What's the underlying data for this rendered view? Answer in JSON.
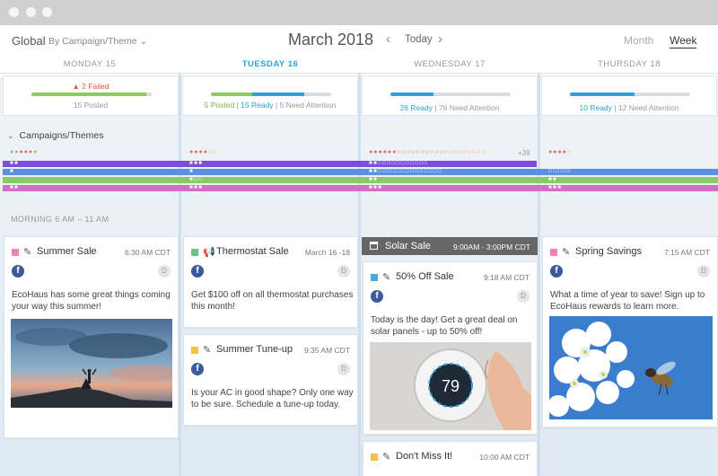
{
  "header": {
    "scope": "Global",
    "group_by": "By Campaign/Theme",
    "title": "March 2018",
    "today": "Today",
    "prev": "‹",
    "next": "›",
    "views": {
      "month": "Month",
      "week": "Week"
    }
  },
  "days": [
    {
      "label": "MONDAY 15"
    },
    {
      "label": "TUESDAY 16"
    },
    {
      "label": "WEDNESDAY 17"
    },
    {
      "label": "THURSDAY 18"
    }
  ],
  "status": {
    "monday": {
      "failed": "2 Failed",
      "posted": "15 Posted",
      "failed_icon": "warning-icon"
    },
    "tuesday": {
      "posted": "5 Posted",
      "sep": "|",
      "ready": "15 Ready",
      "sep2": "|",
      "attention": "5 Need Attention"
    },
    "wednesday": {
      "ready": "26 Ready",
      "sep": "|",
      "attention": "76 Need Attention"
    },
    "thursday": {
      "ready": "10 Ready",
      "sep": "|",
      "attention": "12 Need Attention"
    }
  },
  "campaigns": {
    "label": "Campaigns/Themes",
    "chevron": "⌄",
    "wednesday_more": "+39",
    "stripe_colors": [
      "#7b4fd6",
      "#5b8fe0",
      "#8cc865",
      "#d86bc7"
    ]
  },
  "morning_label": "MORNING 6 AM – 11 AM",
  "cards": {
    "summer_sale": {
      "title": "Summer Sale",
      "time": "6:30 AM CDT",
      "body": "EcoHaus has some great things coming your way this summer!",
      "color": "#f081b8",
      "network": "f",
      "avatar": "D"
    },
    "thermostat_sale": {
      "title": "Thermostat Sale",
      "time": "March 16 -18",
      "body": "Get $100 off on all thermostat purchases this month!",
      "color": "#6ec18a",
      "network": "f",
      "avatar": "D",
      "icon": "megaphone-icon"
    },
    "summer_tuneup": {
      "title": "Summer Tune-up",
      "time": "9:35 AM CDT",
      "body": "Is your AC in good shape? Only one way to be sure. Schedule a tune-up today.",
      "color": "#f5c343",
      "network": "f",
      "avatar": "D"
    },
    "solar_sale": {
      "title": "Solar Sale",
      "time": "9:00AM - 3:00PM CDT"
    },
    "fifty_off": {
      "title": "50% Off Sale",
      "time": "9:18 AM CDT",
      "body": "Today is the day! Get a great deal on solar panels - up to 50% off!",
      "color": "#48a8de",
      "network": "f",
      "avatar": "D",
      "thermostat_reading": "79"
    },
    "dont_miss": {
      "title": "Don't Miss It!",
      "time": "10:00 AM CDT",
      "color": "#f5c343"
    },
    "spring_savings": {
      "title": "Spring Savings",
      "time": "7:15 AM CDT",
      "body": "What a time of year to save! Sign up to EcoHaus rewards to learn more.",
      "color": "#f081b8",
      "network": "f",
      "avatar": "D"
    }
  }
}
